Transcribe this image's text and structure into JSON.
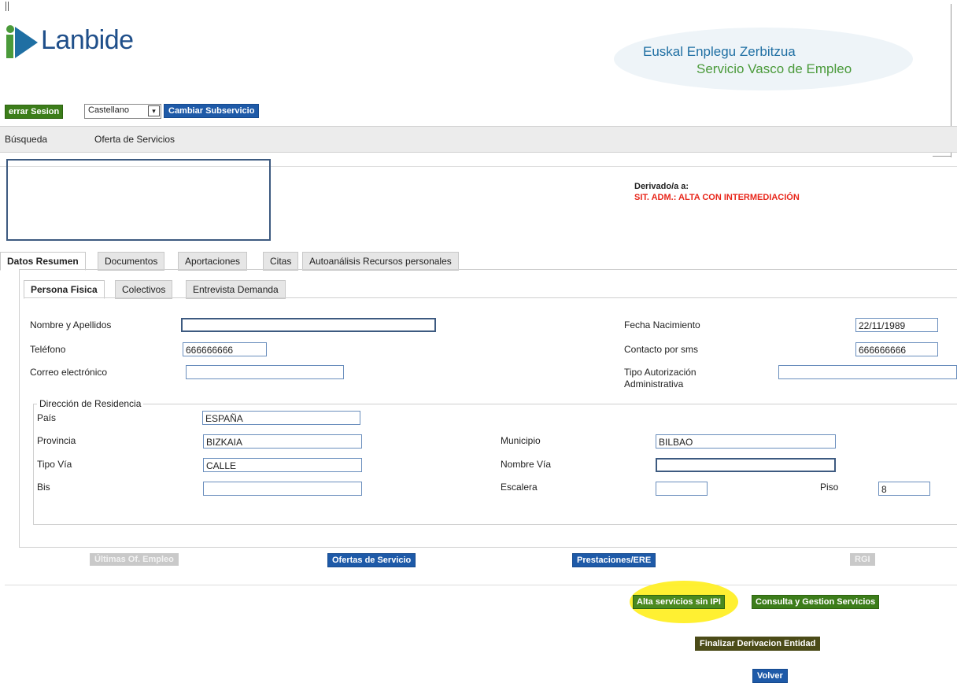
{
  "header": {
    "logo_text": "Lanbide",
    "brand_line1": "Euskal Enplegu Zerbitzua",
    "brand_line2": "Servicio Vasco de Empleo"
  },
  "toolbar": {
    "cerrar_sesion": "errar Sesion",
    "language": "Castellano",
    "cambiar_subservicio": "Cambiar Subservicio"
  },
  "nav": {
    "items": [
      "Búsqueda",
      "Oferta de Servicios"
    ]
  },
  "info": {
    "derivado": "Derivado/a a:",
    "sit_adm": "SIT. ADM.: ALTA CON INTERMEDIACIÓN"
  },
  "tabs": [
    "Datos Resumen",
    "Documentos",
    "Aportaciones",
    "Citas",
    "Autoanálisis Recursos personales"
  ],
  "subtabs": [
    "Persona Fisica",
    "Colectivos",
    "Entrevista Demanda"
  ],
  "fields": {
    "nombre_label": "Nombre y Apellidos",
    "nombre_value": "",
    "telefono_label": "Teléfono",
    "telefono_value": "666666666",
    "correo_label": "Correo electrónico",
    "correo_value": "",
    "fecha_label": "Fecha Nacimiento",
    "fecha_value": "22/11/1989",
    "sms_label": "Contacto por sms",
    "sms_value": "666666666",
    "autorizacion_label1": "Tipo Autorización",
    "autorizacion_label2": "Administrativa",
    "autorizacion_value": ""
  },
  "direccion": {
    "legend": "Dirección de Residencia",
    "pais_label": "País",
    "pais_value": "ESPAÑA",
    "provincia_label": "Provincia",
    "provincia_value": "BIZKAIA",
    "municipio_label": "Municipio",
    "municipio_value": "BILBAO",
    "tipo_via_label": "Tipo Vía",
    "tipo_via_value": "CALLE",
    "nombre_via_label": "Nombre Vía",
    "nombre_via_value": "",
    "bis_label": "Bis",
    "bis_value": "",
    "escalera_label": "Escalera",
    "escalera_value": "",
    "piso_label": "Piso",
    "piso_value": "8"
  },
  "actions": {
    "ultimas": "Últimas Of. Empleo",
    "ofertas": "Ofertas de Servicio",
    "prestaciones": "Prestaciones/ERE",
    "rgi": "RGI",
    "alta": "Alta servicios sin IPI",
    "consulta": "Consulta y Gestion Servicios",
    "finalizar": "Finalizar Derivacion Entidad",
    "volver": "Volver"
  }
}
